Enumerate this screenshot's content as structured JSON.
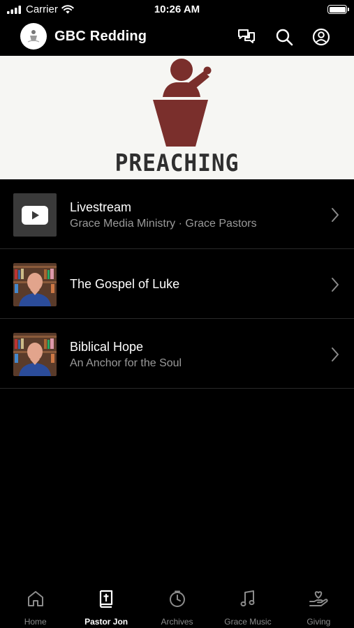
{
  "status_bar": {
    "carrier": "Carrier",
    "time": "10:26 AM"
  },
  "header": {
    "title": "GBC Redding",
    "icons": [
      "chat-icon",
      "search-icon",
      "account-icon"
    ]
  },
  "hero": {
    "text": "PREACHING",
    "accent_color": "#7a2f2c"
  },
  "list": [
    {
      "title": "Livestream",
      "subtitle": "Grace Media Ministry · Grace Pastors",
      "thumb": "youtube-icon"
    },
    {
      "title": "The Gospel of Luke",
      "subtitle": "",
      "thumb": "pastor-photo"
    },
    {
      "title": "Biblical Hope",
      "subtitle": "An Anchor for the Soul",
      "thumb": "pastor-photo"
    }
  ],
  "tabs": [
    {
      "label": "Home",
      "icon": "home-icon",
      "active": false
    },
    {
      "label": "Pastor Jon",
      "icon": "bible-icon",
      "active": true
    },
    {
      "label": "Archives",
      "icon": "clock-icon",
      "active": false
    },
    {
      "label": "Grace Music",
      "icon": "music-note-icon",
      "active": false
    },
    {
      "label": "Giving",
      "icon": "giving-hand-icon",
      "active": false
    }
  ]
}
